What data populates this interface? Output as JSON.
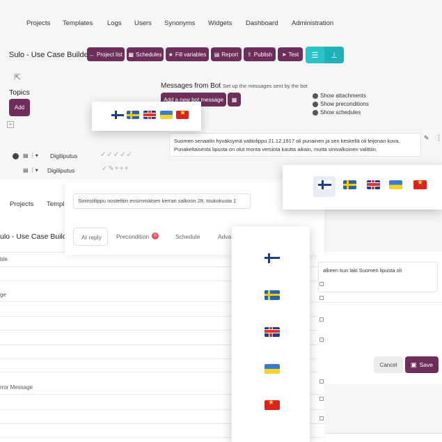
{
  "nav": {
    "projects": "Projects",
    "templates": "Templates",
    "logs": "Logs",
    "users": "Users",
    "synonyms": "Synonyms",
    "widgets": "Widgets",
    "dashboard": "Dashboard",
    "administration": "Administration"
  },
  "header": {
    "title": "Sulo - Use Case Builder"
  },
  "toolbar": {
    "project_list": "Project list",
    "schedules": "Schedules",
    "fill_variables": "Fill variables",
    "report": "Report",
    "publish": "Publish",
    "test": "Test"
  },
  "topics": {
    "heading": "Topics",
    "add": "Add"
  },
  "messages": {
    "heading": "Messages from Bot",
    "subtitle": "Set up the messages sent by the bot",
    "add_new": "Add a new bot message"
  },
  "options": {
    "attachments": "Show attachments",
    "preconditions": "Show preconditions",
    "schedules": "Show schedules"
  },
  "message_text": "Suomen senaatin hyväksymä valtiolippu 21.12.1917 oli punainen ja sen keskellä oli leijonan kuva. Punakeltaisesta lipusta on olut monta versiota kautta aikain, mutta sinivalkoinen valittiin.",
  "rows": [
    {
      "label": "Digiliputus",
      "status": "✓✓✓✓✓"
    },
    {
      "label": "Digiliputus",
      "status": "✓✎+++"
    }
  ],
  "flags": [
    "FI",
    "SE",
    "GB",
    "UA",
    "VN"
  ],
  "back": {
    "nav_projects": "Projects",
    "nav_templates": "Templ",
    "title": "ulo - Use Case Builder",
    "labels": [
      "ble",
      "ge",
      "rror Message"
    ]
  },
  "editor": {
    "input_value": "Siniristilippu nostettiin ensimmäisen kerran salkoon 28. toukokuuta 1",
    "tabs": {
      "ai_reply": "AI reply",
      "precondition": "Precondition",
      "precondition_count": "0",
      "schedule": "Schedule",
      "advanced": "Adva"
    }
  },
  "dialog": {
    "text_line1": "alkeen kun laki Suomen lipusta oli",
    "text_line2": "",
    "cancel": "Cancel",
    "save": "Save"
  },
  "colors": {
    "primary": "#6d2e5a",
    "teal": "#26c3c9",
    "badge": "#e2525c"
  }
}
